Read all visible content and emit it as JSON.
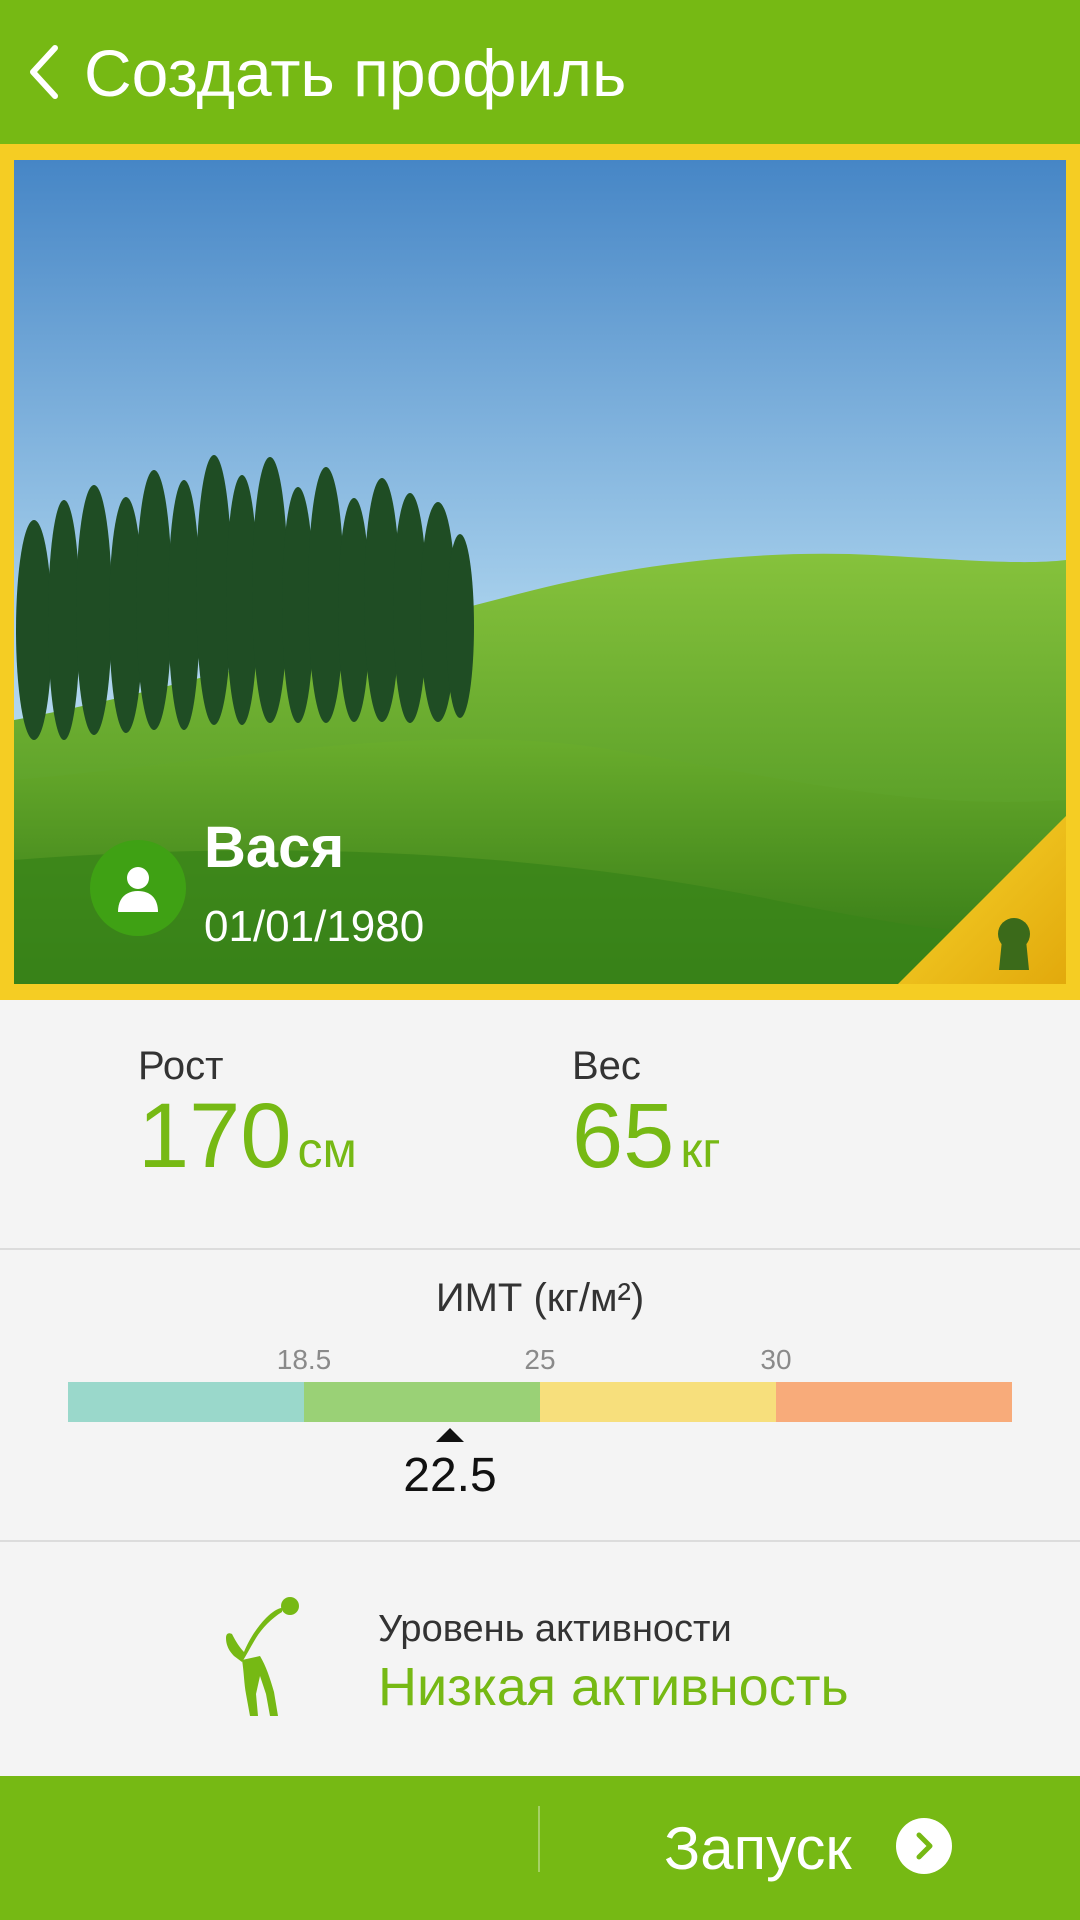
{
  "header": {
    "title": "Создать профиль",
    "back_icon": "chevron-left-icon"
  },
  "profile": {
    "name": "Вася",
    "birthdate": "01/01/1980",
    "avatar_icon": "person-icon",
    "lock_icon": "keyhole-lock-icon"
  },
  "metrics": {
    "height": {
      "label": "Рост",
      "value": "170",
      "unit": "см"
    },
    "weight": {
      "label": "Вес",
      "value": "65",
      "unit": "кг"
    }
  },
  "bmi": {
    "title": "ИМТ (кг/м²)",
    "ticks": [
      "18.5",
      "25",
      "30"
    ],
    "value": "22.5",
    "segment_colors": [
      "#9ad8cb",
      "#9ad176",
      "#f7df7c",
      "#f8ab7a"
    ]
  },
  "activity": {
    "label": "Уровень активности",
    "value": "Низкая активность",
    "icon": "stretching-person-icon"
  },
  "footer": {
    "start_label": "Запуск",
    "start_icon": "chevron-right-circle-icon"
  },
  "colors": {
    "accent": "#76b914",
    "card_border": "#f5cd23"
  }
}
